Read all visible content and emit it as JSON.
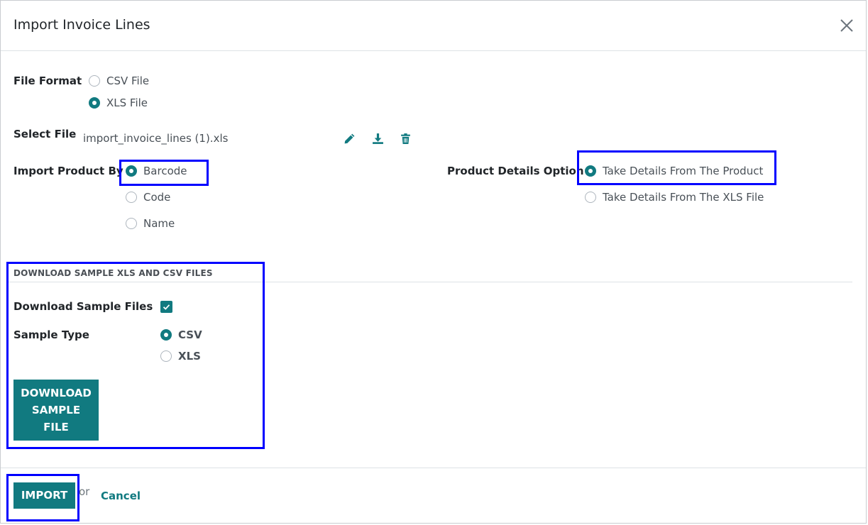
{
  "dialog": {
    "title": "Import Invoice Lines"
  },
  "file_format": {
    "label": "File Format",
    "options": [
      {
        "label": "CSV File",
        "selected": false
      },
      {
        "label": "XLS File",
        "selected": true
      }
    ]
  },
  "select_file": {
    "label": "Select File",
    "filename": "import_invoice_lines (1).xls"
  },
  "import_product_by": {
    "label": "Import Product By",
    "options": [
      {
        "label": "Barcode",
        "selected": true
      },
      {
        "label": "Code",
        "selected": false
      },
      {
        "label": "Name",
        "selected": false
      }
    ]
  },
  "product_details_option": {
    "label": "Product Details Option",
    "options": [
      {
        "label": "Take Details From The Product",
        "selected": true
      },
      {
        "label": "Take Details From The XLS File",
        "selected": false
      }
    ]
  },
  "sample_section": {
    "title": "DOWNLOAD SAMPLE XLS AND CSV FILES",
    "download_sample_label": "Download Sample Files",
    "download_sample_checked": true,
    "sample_type_label": "Sample Type",
    "sample_type_options": [
      {
        "label": "CSV",
        "selected": true
      },
      {
        "label": "XLS",
        "selected": false
      }
    ],
    "download_button": "DOWNLOAD SAMPLE FILE"
  },
  "footer": {
    "import_button": "IMPORT",
    "or_text": "or",
    "cancel_link": "Cancel"
  },
  "colors": {
    "primary": "#117a80",
    "highlight": "#0000ff"
  },
  "icons": [
    "close-icon",
    "pencil-icon",
    "download-icon",
    "trash-icon",
    "check-icon"
  ]
}
